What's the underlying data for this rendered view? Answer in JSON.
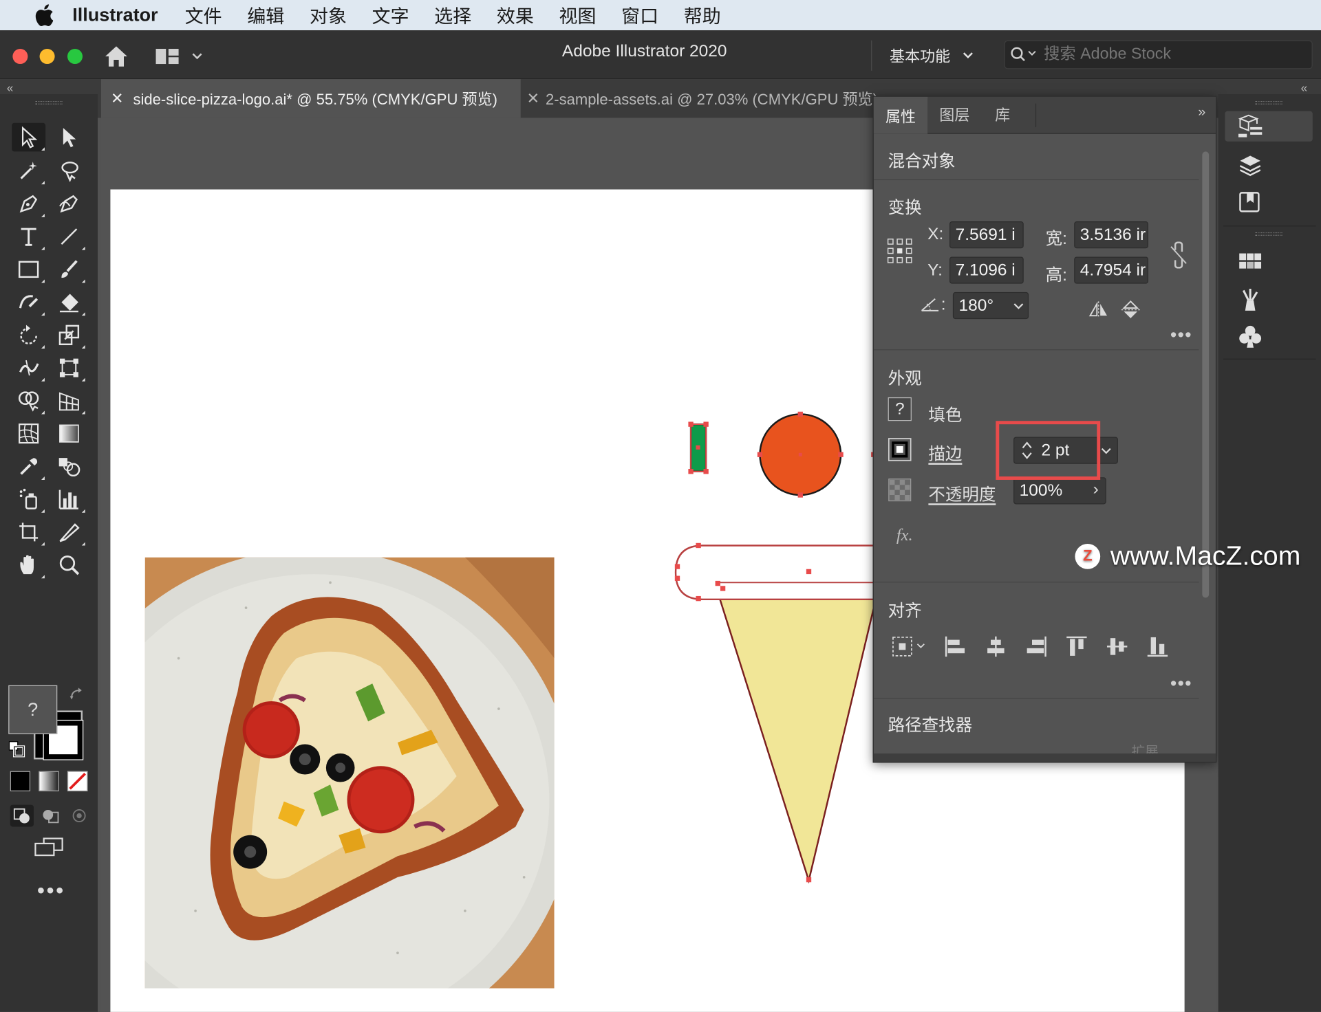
{
  "menubar": {
    "app": "Illustrator",
    "items": [
      "文件",
      "编辑",
      "对象",
      "文字",
      "选择",
      "效果",
      "视图",
      "窗口",
      "帮助"
    ]
  },
  "titlebar": {
    "title": "Adobe Illustrator 2020",
    "workspace": "基本功能",
    "search_placeholder": "搜索 Adobe Stock"
  },
  "tabs": [
    {
      "label": "side-slice-pizza-logo.ai* @ 55.75% (CMYK/GPU 预览)",
      "active": true
    },
    {
      "label": "2-sample-assets.ai @ 27.03% (CMYK/GPU 预览)",
      "active": false
    }
  ],
  "panel": {
    "tabs": [
      "属性",
      "图层",
      "库"
    ],
    "object_type": "混合对象",
    "transform": {
      "title": "变换",
      "x_label": "X:",
      "x": "7.5691 i",
      "y_label": "Y:",
      "y": "7.1096 i",
      "w_label": "宽:",
      "w": "3.5136 ir",
      "h_label": "高:",
      "h": "4.7954 ir",
      "angle": "180°"
    },
    "appearance": {
      "title": "外观",
      "fill_label": "填色",
      "fill_value": "?",
      "stroke_label": "描边",
      "stroke_value": "2 pt",
      "opacity_label": "不透明度",
      "opacity_value": "100%",
      "fx_label": "fx."
    },
    "align": {
      "title": "对齐"
    },
    "pathfinder": {
      "title": "路径查找器",
      "expand": "扩展"
    }
  },
  "toolbar": {
    "fill_value": "?"
  },
  "watermark": {
    "text": "www.MacZ.com",
    "logo_letter": "Z"
  },
  "colors": {
    "highlight": "#e84b4b",
    "circle": "#e8531e",
    "cone": "#f1e697",
    "green_rect": "#0f9b4a"
  }
}
